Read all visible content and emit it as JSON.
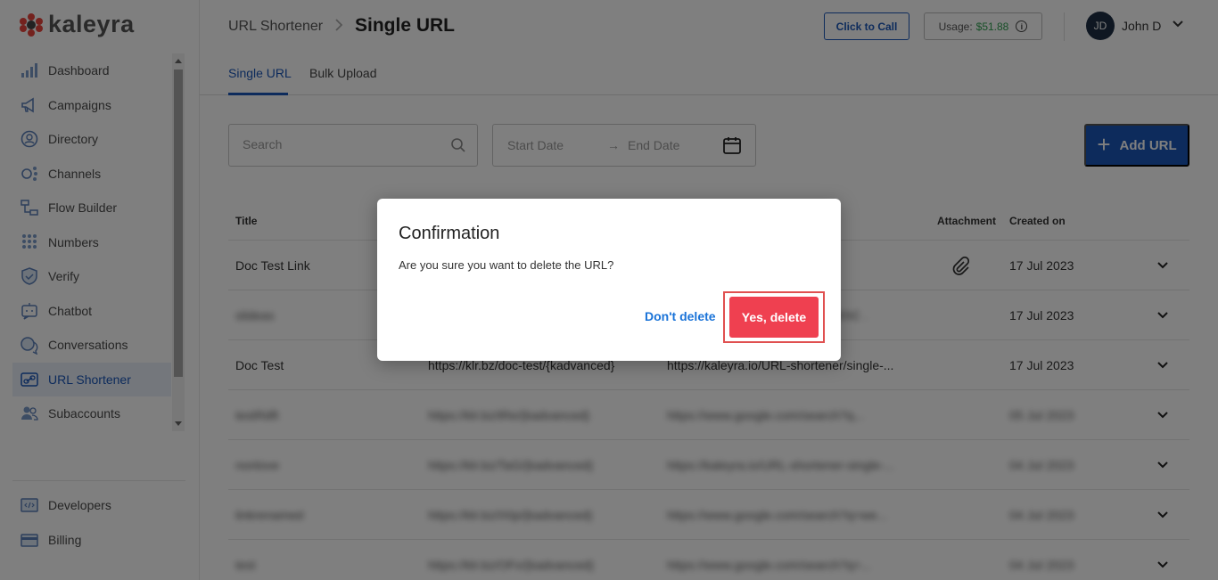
{
  "brand": {
    "name": "kaleyra"
  },
  "sidebar": {
    "items": [
      {
        "label": "Dashboard",
        "icon": "bar-chart-icon"
      },
      {
        "label": "Campaigns",
        "icon": "megaphone-icon"
      },
      {
        "label": "Directory",
        "icon": "contact-icon"
      },
      {
        "label": "Channels",
        "icon": "channels-icon"
      },
      {
        "label": "Flow Builder",
        "icon": "flow-icon"
      },
      {
        "label": "Numbers",
        "icon": "dial-pad-icon"
      },
      {
        "label": "Verify",
        "icon": "shield-icon"
      },
      {
        "label": "Chatbot",
        "icon": "chatbot-icon"
      },
      {
        "label": "Conversations",
        "icon": "chat-bubbles-icon"
      },
      {
        "label": "URL Shortener",
        "icon": "link-icon",
        "active": true
      },
      {
        "label": "Subaccounts",
        "icon": "users-icon"
      }
    ],
    "bottom_items": [
      {
        "label": "Developers",
        "icon": "code-icon"
      },
      {
        "label": "Billing",
        "icon": "credit-card-icon"
      }
    ]
  },
  "header": {
    "breadcrumb_parent": "URL Shortener",
    "breadcrumb_current": "Single URL",
    "click_to_call": "Click to Call",
    "usage_label": "Usage:",
    "usage_amount": "$51.88",
    "user_initials": "JD",
    "user_name": "John D"
  },
  "tabs": [
    {
      "label": "Single URL",
      "active": true
    },
    {
      "label": "Bulk Upload",
      "active": false
    }
  ],
  "filters": {
    "search_placeholder": "Search",
    "start_date_placeholder": "Start Date",
    "end_date_placeholder": "End Date",
    "add_url_label": "Add URL"
  },
  "table": {
    "columns": {
      "title": "Title",
      "attachment": "Attachment",
      "created_on": "Created on"
    },
    "rows": [
      {
        "title": "Doc Test Link",
        "short": "",
        "long": "",
        "attachment": true,
        "date": "17 Jul 2023",
        "blurred": false
      },
      {
        "title": "slideas",
        "short": "",
        "long": "…ZCAKhC .",
        "attachment": false,
        "date": "17 Jul 2023",
        "blurred_text": true
      },
      {
        "title": "Doc Test",
        "short": "https://klr.bz/doc-test/{kadvanced}",
        "long": "https://kaleyra.io/URL-shortener/single-...",
        "attachment": false,
        "date": "17 Jul 2023",
        "blurred": false
      },
      {
        "title": "testRdft",
        "short": "https://klr.bz/tRe/{kadvanced}",
        "long": "https://www.google.com/search?q...",
        "attachment": false,
        "date": "05 Jul 2023",
        "blurred": true
      },
      {
        "title": "nonlove",
        "short": "https://klr.bz/TaG/{kadvanced}",
        "long": "https://kaleyra.io/URL-shortener-single-...",
        "attachment": false,
        "date": "04 Jul 2023",
        "blurred": true
      },
      {
        "title": "linkrenamed",
        "short": "https://klr.bz/IXtp/{kadvanced}",
        "long": "https://www.google.com/search?q=we...",
        "attachment": false,
        "date": "04 Jul 2023",
        "blurred": true
      },
      {
        "title": "test",
        "short": "https://klr.bz/OFx/{kadvanced}",
        "long": "https://www.google.com/search?q=...",
        "attachment": false,
        "date": "04 Jul 2023",
        "blurred": true
      }
    ]
  },
  "dialog": {
    "title": "Confirmation",
    "message": "Are you sure you want to delete the URL?",
    "cancel_label": "Don't delete",
    "confirm_label": "Yes, delete"
  },
  "colors": {
    "primary": "#1a56b8",
    "danger": "#ef4050",
    "usage_amount": "#2e9e4f",
    "brand_red": "#e8453c"
  }
}
